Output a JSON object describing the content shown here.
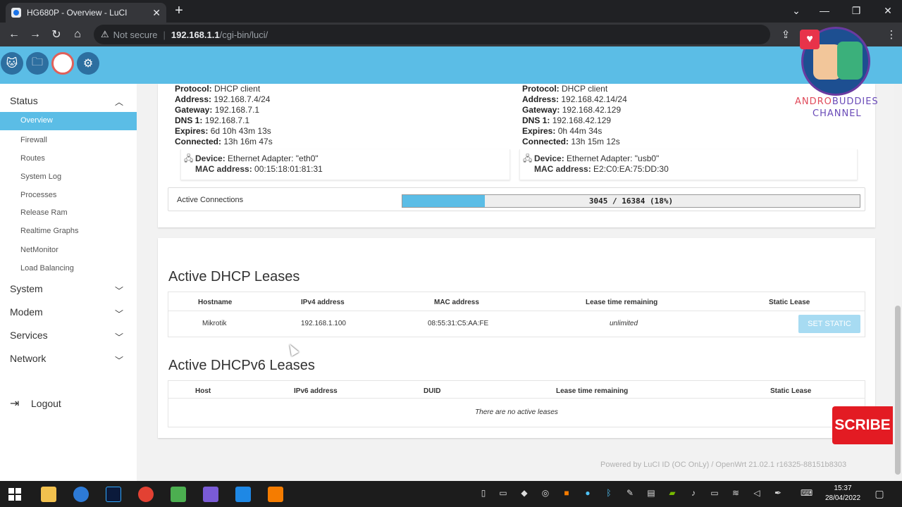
{
  "browser": {
    "tab_title": "HG680P - Overview - LuCI",
    "not_secure": "Not secure",
    "url_host": "192.168.1.1",
    "url_path": "/cgi-bin/luci/"
  },
  "sidebar": {
    "status": "Status",
    "status_items": [
      "Overview",
      "Firewall",
      "Routes",
      "System Log",
      "Processes",
      "Release Ram",
      "Realtime Graphs",
      "NetMonitor",
      "Load Balancing"
    ],
    "system": "System",
    "modem": "Modem",
    "services": "Services",
    "network": "Network",
    "logout": "Logout"
  },
  "wan1": {
    "protocol_label": "Protocol:",
    "protocol": "DHCP client",
    "address_label": "Address:",
    "address": "192.168.7.4/24",
    "gateway_label": "Gateway:",
    "gateway": "192.168.7.1",
    "dns_label": "DNS 1:",
    "dns": "192.168.7.1",
    "expires_label": "Expires:",
    "expires": "6d 10h 43m 13s",
    "connected_label": "Connected:",
    "connected": "13h 16m 47s",
    "device_label": "Device:",
    "device": "Ethernet Adapter: \"eth0\"",
    "mac_label": "MAC address:",
    "mac": "00:15:18:01:81:31"
  },
  "wan2": {
    "protocol_label": "Protocol:",
    "protocol": "DHCP client",
    "address_label": "Address:",
    "address": "192.168.42.14/24",
    "gateway_label": "Gateway:",
    "gateway": "192.168.42.129",
    "dns_label": "DNS 1:",
    "dns": "192.168.42.129",
    "expires_label": "Expires:",
    "expires": "0h 44m 34s",
    "connected_label": "Connected:",
    "connected": "13h 15m 12s",
    "device_label": "Device:",
    "device": "Ethernet Adapter: \"usb0\"",
    "mac_label": "MAC address:",
    "mac": "E2:C0:EA:75:DD:30"
  },
  "connections": {
    "label": "Active Connections",
    "text": "3045 / 16384 (18%)",
    "fraction": 0.18
  },
  "dhcp": {
    "title": "Active DHCP Leases",
    "headers": [
      "Hostname",
      "IPv4 address",
      "MAC address",
      "Lease time remaining",
      "Static Lease"
    ],
    "row": {
      "hostname": "Mikrotik",
      "ipv4": "192.168.1.100",
      "mac": "08:55:31:C5:AA:FE",
      "lease": "unlimited",
      "button": "SET STATIC"
    }
  },
  "dhcp6": {
    "title": "Active DHCPv6 Leases",
    "headers": [
      "Host",
      "IPv6 address",
      "DUID",
      "Lease time remaining",
      "Static Lease"
    ],
    "empty": "There are no active leases"
  },
  "footer": "Powered by LuCI ID (OC OnLy) / OpenWrt 21.02.1 r16325-88151b8303",
  "overlay": {
    "brand_a": "ANDRO",
    "brand_b": "BUDDIES",
    "brand_c": "CHANNEL",
    "subscribe": "SCRIBE"
  },
  "taskbar": {
    "time": "15:37",
    "date": "28/04/2022"
  },
  "colors": {
    "accent": "#5bbde6",
    "header": "#5bbde6",
    "subscribe": "#e31b23"
  }
}
